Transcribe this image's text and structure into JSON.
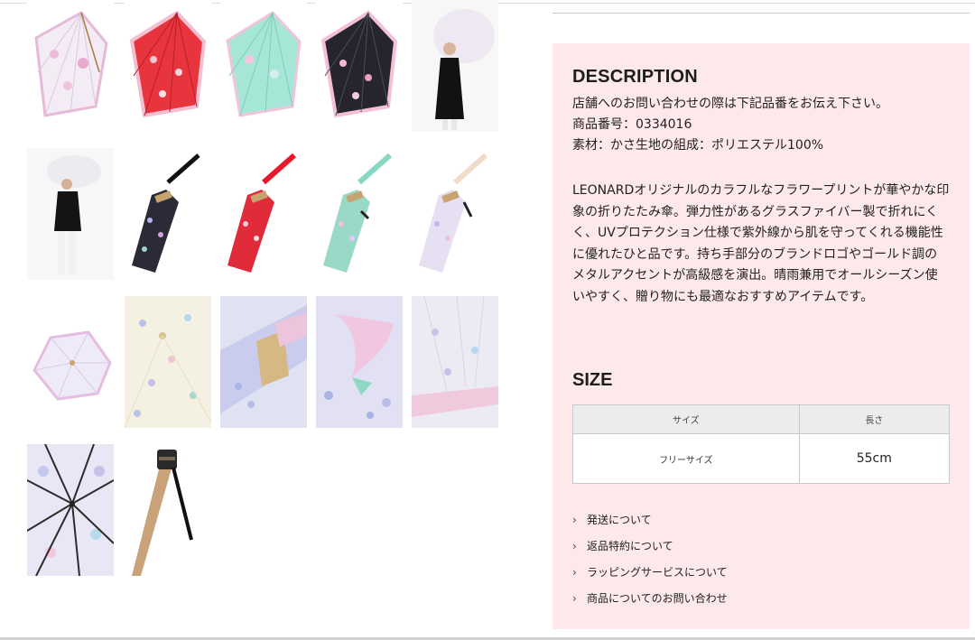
{
  "description": {
    "heading": "DESCRIPTION",
    "line1": "店舗へのお問い合わせの際は下記品番をお伝え下さい。",
    "line2": "商品番号：0334016",
    "line3": "素材：かさ生地の組成：ポリエステル100%",
    "paragraph": "LEONARDオリジナルのカラフルなフラワープリントが華やかな印象の折りたたみ傘。弾力性があるグラスファイバー製で折れにくく、UVプロテクション仕様で紫外線から肌を守ってくれる機能性に優れたひと品です。持ち手部分のブランドロゴやゴールド調のメタルアクセントが高級感を演出。晴雨兼用でオールシーズン使いやすく、贈り物にも最適なおすすめアイテムです。"
  },
  "size": {
    "heading": "SIZE",
    "header_size": "サイズ",
    "header_length": "長さ",
    "value_size": "フリーサイズ",
    "value_length": "55cm"
  },
  "links": [
    {
      "label": "発送について"
    },
    {
      "label": "返品特約について"
    },
    {
      "label": "ラッピングサービスについて"
    },
    {
      "label": "商品についてのお問い合わせ"
    }
  ],
  "gallery": {
    "images": [
      {
        "subject": "open umbrella",
        "color": "#f2c6df"
      },
      {
        "subject": "open umbrella",
        "color": "#e8343d"
      },
      {
        "subject": "open umbrella",
        "color": "#9fe3d2"
      },
      {
        "subject": "open umbrella",
        "color": "#222222"
      },
      {
        "subject": "model holding umbrella",
        "color": "#e4e4ec"
      },
      {
        "subject": "model holding umbrella",
        "color": "#e4e4ec"
      },
      {
        "subject": "folded umbrella",
        "color": "#2b2b38"
      },
      {
        "subject": "folded umbrella",
        "color": "#e02b3a"
      },
      {
        "subject": "folded umbrella",
        "color": "#8fd8c4"
      },
      {
        "subject": "folded umbrella",
        "color": "#e6ddf0"
      },
      {
        "subject": "open umbrella top",
        "color": "#eae6f6"
      },
      {
        "subject": "fabric detail",
        "color": "#f3efe2"
      },
      {
        "subject": "handle detail",
        "color": "#c9cde8"
      },
      {
        "subject": "flower print detail",
        "color": "#e9e3f6"
      },
      {
        "subject": "edge detail",
        "color": "#eceaf2"
      },
      {
        "subject": "inside frame",
        "color": "#e8e6f4"
      },
      {
        "subject": "handle",
        "color": "#c8a078"
      }
    ]
  },
  "colors": {
    "panel_bg": "#fde8ea",
    "table_header_bg": "#ececec"
  }
}
